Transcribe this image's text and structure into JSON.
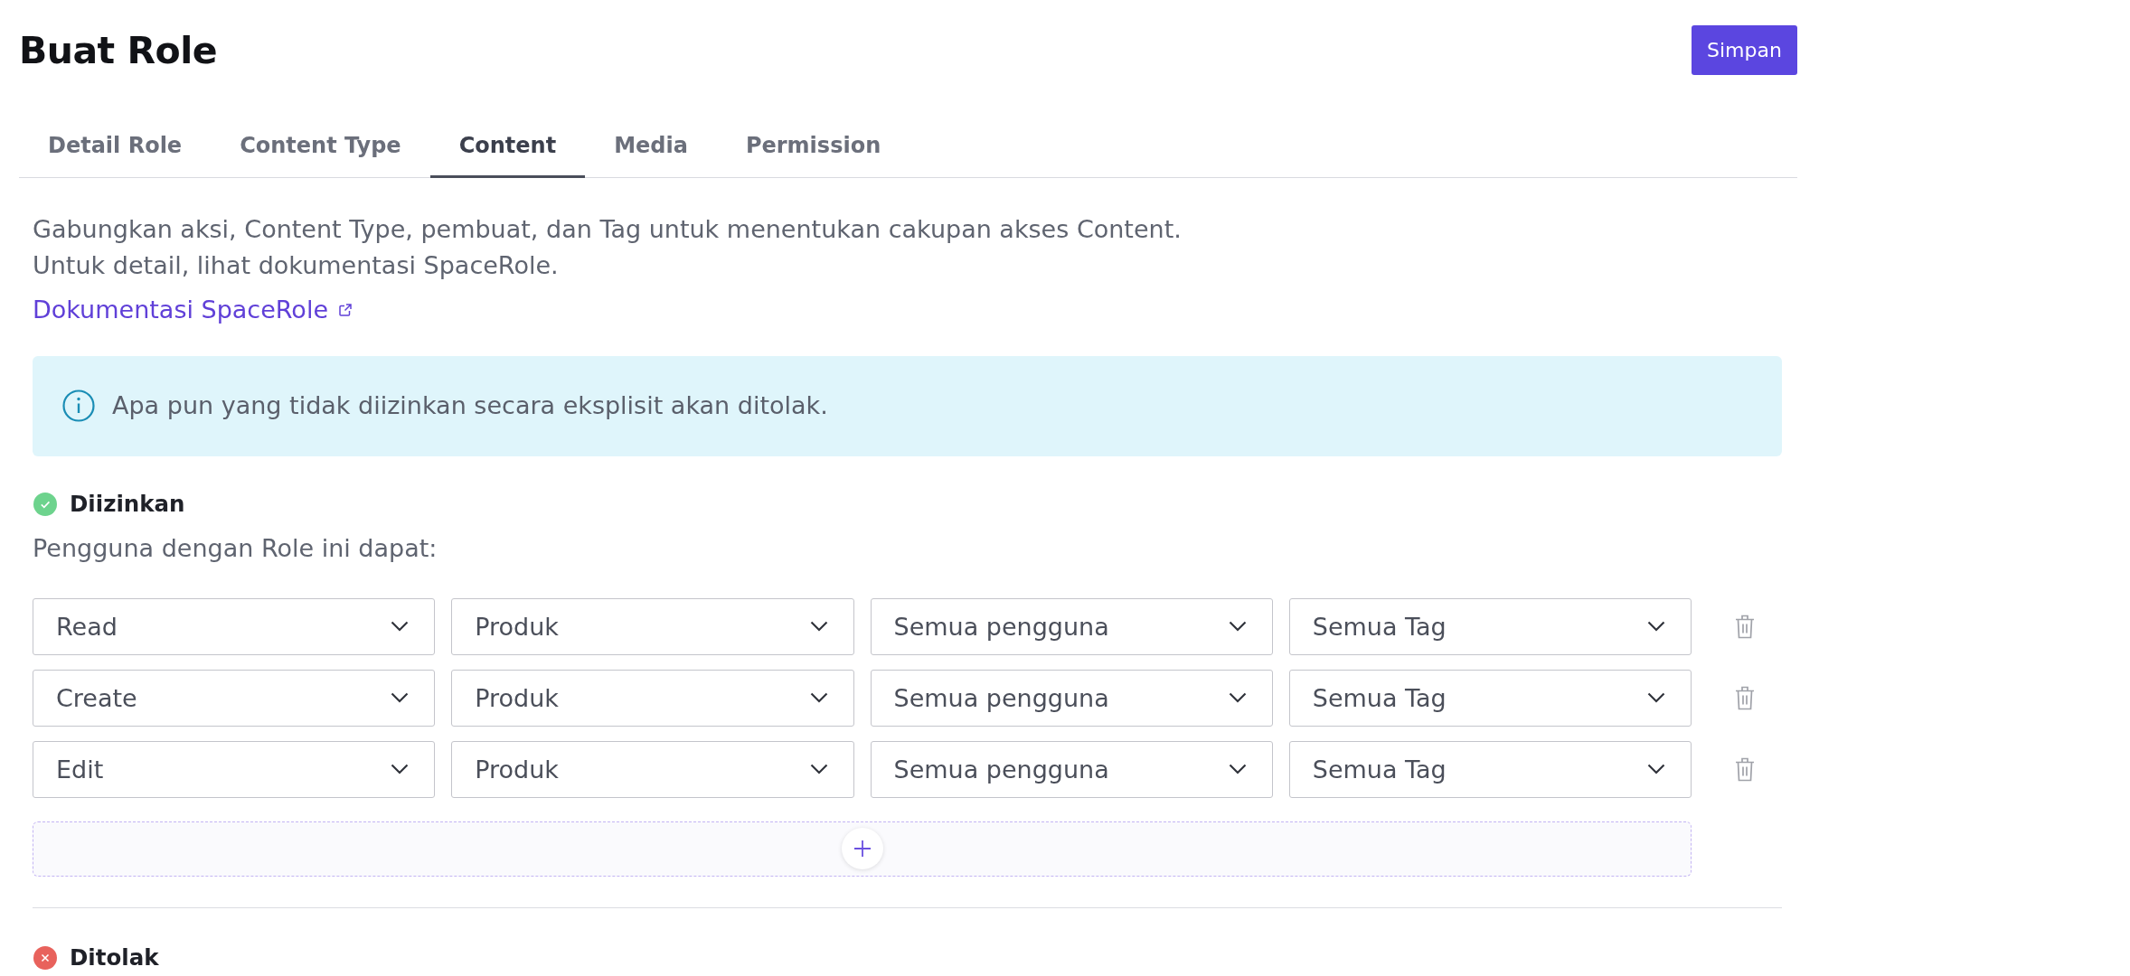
{
  "header": {
    "title": "Buat Role",
    "save_button": "Simpan"
  },
  "tabs": [
    {
      "label": "Detail Role",
      "selected": false
    },
    {
      "label": "Content Type",
      "selected": false
    },
    {
      "label": "Content",
      "selected": true
    },
    {
      "label": "Media",
      "selected": false
    },
    {
      "label": "Permission",
      "selected": false
    }
  ],
  "description": {
    "lines": [
      "Gabungkan aksi, Content Type, pembuat, dan Tag untuk menentukan cakupan akses Content.",
      "Untuk detail, lihat dokumentasi SpaceRole."
    ],
    "link": "Dokumentasi SpaceRole"
  },
  "notice": {
    "text": "Apa pun yang tidak diizinkan secara eksplisit akan ditolak."
  },
  "sections": [
    {
      "kind": "allowed",
      "title": "Diizinkan",
      "subtitle": "Pengguna dengan Role ini dapat:",
      "rules": [
        {
          "fields": [
            "Read",
            "Produk",
            "Semua pengguna",
            "Semua Tag"
          ]
        },
        {
          "fields": [
            "Create",
            "Produk",
            "Semua pengguna",
            "Semua Tag"
          ]
        },
        {
          "fields": [
            "Edit",
            "Produk",
            "Semua pengguna",
            "Semua Tag"
          ]
        }
      ],
      "can_add": true
    },
    {
      "kind": "denied",
      "title": "Ditolak"
    }
  ]
}
